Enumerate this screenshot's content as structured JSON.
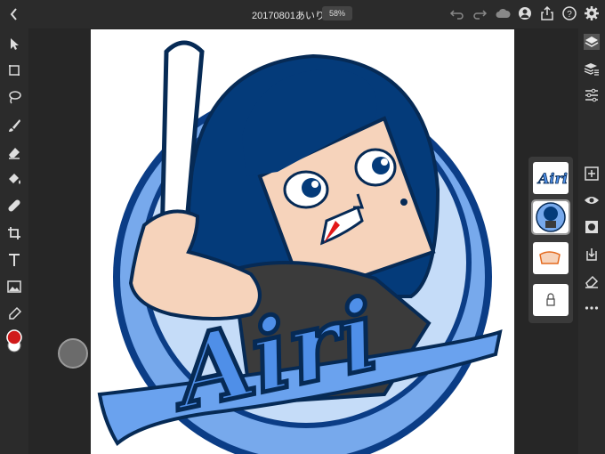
{
  "document": {
    "title": "20170801あいり",
    "zoom": "58%"
  },
  "toolbar_left": {
    "tools": [
      "move-tool",
      "transform-tool",
      "lasso-tool",
      "brush-tool",
      "eraser-tool",
      "fill-tool",
      "healing-tool",
      "crop-tool",
      "type-tool",
      "image-tool",
      "eyedropper-tool"
    ]
  },
  "toolbar_top_right": {
    "icons": [
      "undo-icon",
      "redo-icon",
      "cloud-icon",
      "user-icon",
      "share-icon",
      "help-icon",
      "settings-icon"
    ]
  },
  "right_panel": {
    "icons": [
      "layers-icon",
      "layer-properties-icon",
      "adjustments-icon",
      "add-layer-icon",
      "visibility-icon",
      "mask-icon",
      "import-icon",
      "eraser-layer-icon",
      "more-icon"
    ]
  },
  "canvas_art": {
    "script_text": "Airi"
  },
  "colors": {
    "primary": "#d01a1a",
    "secondary": "#ffffff"
  }
}
